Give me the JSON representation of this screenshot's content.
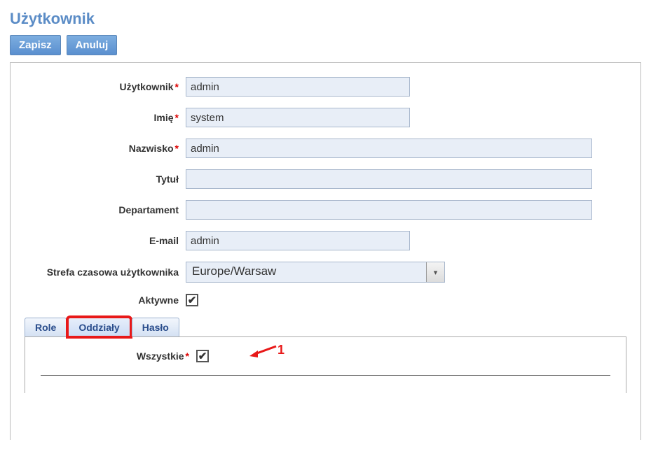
{
  "pageTitle": "Użytkownik",
  "toolbar": {
    "save": "Zapisz",
    "cancel": "Anuluj"
  },
  "asterisk": "*",
  "fields": {
    "user": {
      "label": "Użytkownik",
      "required": true,
      "value": "admin"
    },
    "firstname": {
      "label": "Imię",
      "required": true,
      "value": "system"
    },
    "lastname": {
      "label": "Nazwisko",
      "required": true,
      "value": "admin"
    },
    "title": {
      "label": "Tytuł",
      "required": false,
      "value": ""
    },
    "department": {
      "label": "Departament",
      "required": false,
      "value": ""
    },
    "email": {
      "label": "E-mail",
      "required": false,
      "value": "admin"
    },
    "timezone": {
      "label": "Strefa czasowa użytkownika",
      "required": false,
      "value": "Europe/Warsaw"
    },
    "active": {
      "label": "Aktywne",
      "required": false,
      "checked": true,
      "mark": "✔"
    }
  },
  "tabs": {
    "roles": {
      "label": "Role"
    },
    "branches": {
      "label": "Oddziały"
    },
    "password": {
      "label": "Hasło"
    }
  },
  "branchPanel": {
    "allLabel": "Wszystkie",
    "required": true,
    "checked": true,
    "mark": "✔",
    "annotation": "1"
  }
}
